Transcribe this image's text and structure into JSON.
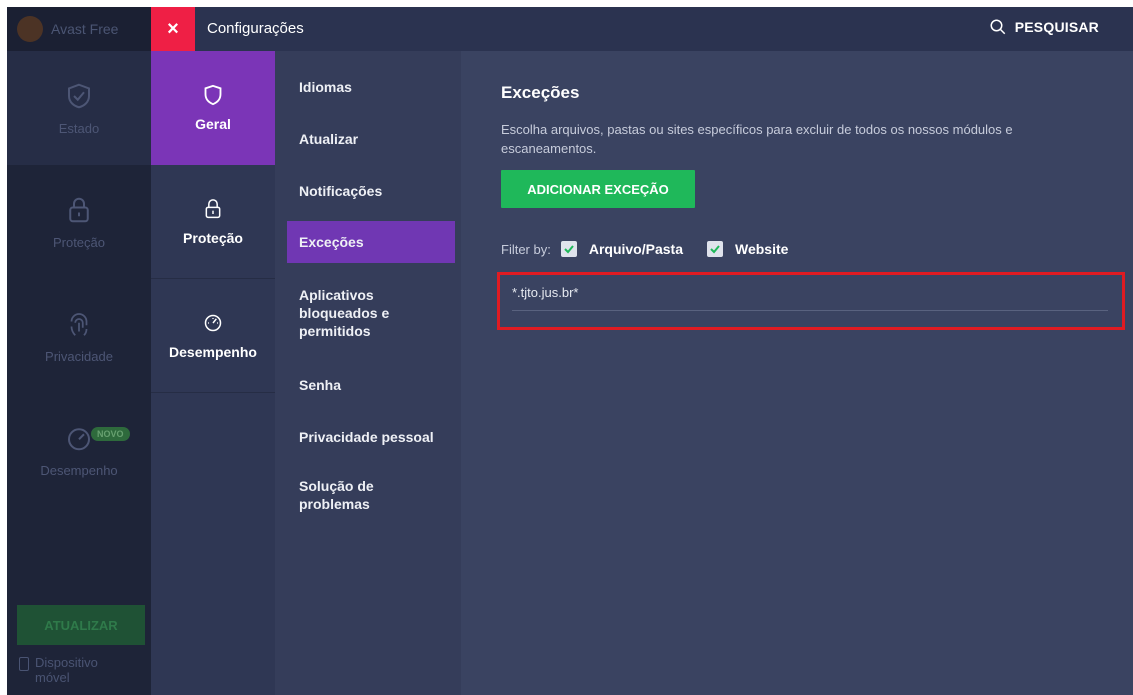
{
  "background_app": {
    "title": "Avast Free",
    "items": [
      {
        "label": "Estado",
        "icon": "shield-check-icon"
      },
      {
        "label": "Proteção",
        "icon": "lock-icon"
      },
      {
        "label": "Privacidade",
        "icon": "fingerprint-icon"
      },
      {
        "label": "Desempenho",
        "icon": "speedometer-icon"
      }
    ],
    "badge": "NOVO",
    "update_button": "ATUALIZAR",
    "mobile_label": "Dispositivo móvel"
  },
  "topbar": {
    "close": "×",
    "title": "Configurações",
    "search_label": "PESQUISAR"
  },
  "categories": [
    {
      "label": "Geral",
      "icon": "shield-icon",
      "active": true
    },
    {
      "label": "Proteção",
      "icon": "lock-icon",
      "active": false
    },
    {
      "label": "Desempenho",
      "icon": "speedometer-icon",
      "active": false
    }
  ],
  "submenu": [
    "Idiomas",
    "Atualizar",
    "Notificações",
    "Exceções",
    "Aplicativos bloqueados e permitidos",
    "Senha",
    "Privacidade pessoal",
    "Solução de problemas"
  ],
  "content": {
    "title": "Exceções",
    "description": "Escolha arquivos, pastas ou sites específicos para excluir de todos os nossos módulos e escaneamentos.",
    "add_button": "ADICIONAR EXCEÇÃO",
    "filter_label": "Filter by:",
    "filters": [
      {
        "label": "Arquivo/Pasta",
        "checked": true
      },
      {
        "label": "Website",
        "checked": true
      }
    ],
    "exceptions": [
      "*.tjto.jus.br*"
    ]
  },
  "colors": {
    "accent_purple": "#7b35b7",
    "close_red": "#ef1f45",
    "button_green": "#1fb85a",
    "highlight_red": "#e01b22"
  }
}
